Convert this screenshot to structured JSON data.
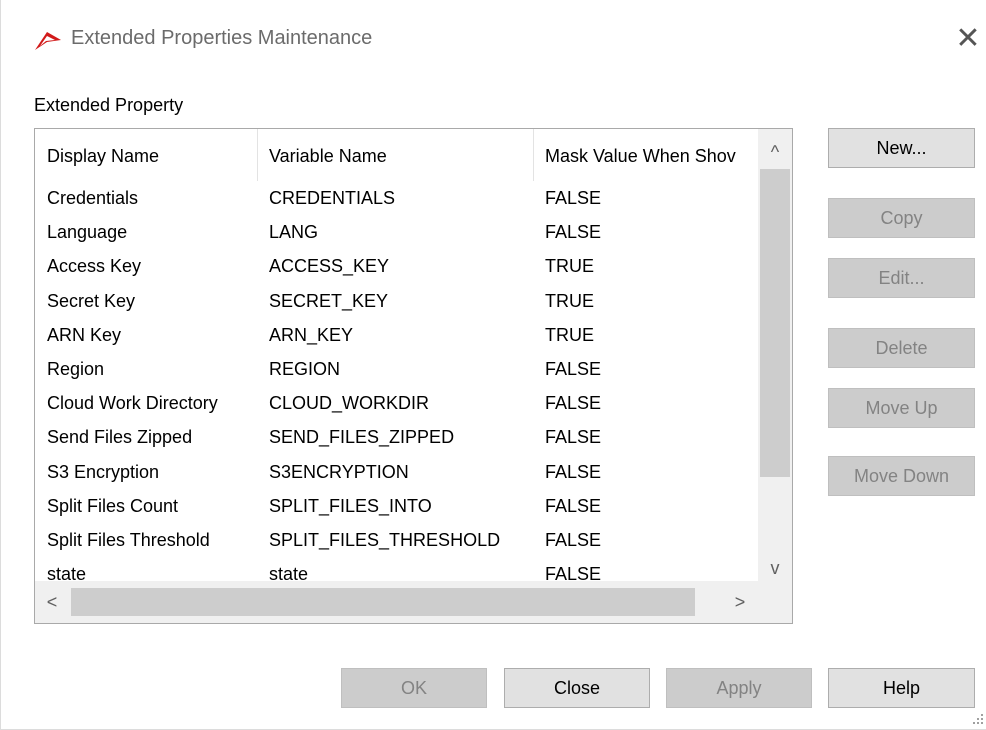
{
  "window": {
    "title": "Extended Properties Maintenance",
    "close_glyph": "✕",
    "icon": "red-arrow-app-icon"
  },
  "group_label": "Extended Property",
  "table": {
    "columns": [
      "Display Name",
      "Variable Name",
      "Mask Value When Shov"
    ],
    "rows": [
      [
        "Credentials",
        "CREDENTIALS",
        "FALSE"
      ],
      [
        "Language",
        "LANG",
        "FALSE"
      ],
      [
        "Access Key",
        "ACCESS_KEY",
        "TRUE"
      ],
      [
        "Secret Key",
        "SECRET_KEY",
        "TRUE"
      ],
      [
        "ARN Key",
        "ARN_KEY",
        "TRUE"
      ],
      [
        "Region",
        "REGION",
        "FALSE"
      ],
      [
        "Cloud Work Directory",
        "CLOUD_WORKDIR",
        "FALSE"
      ],
      [
        "Send Files Zipped",
        "SEND_FILES_ZIPPED",
        "FALSE"
      ],
      [
        "S3 Encryption",
        "S3ENCRYPTION",
        "FALSE"
      ],
      [
        "Split Files Count",
        "SPLIT_FILES_INTO",
        "FALSE"
      ],
      [
        "Split Files Threshold",
        "SPLIT_FILES_THRESHOLD",
        "FALSE"
      ],
      [
        "state",
        "state",
        "FALSE"
      ]
    ],
    "scroll_glyphs": {
      "up": "^",
      "down": "v",
      "left": "<",
      "right": ">"
    }
  },
  "side_buttons": {
    "new": "New...",
    "copy": "Copy",
    "edit": "Edit...",
    "delete": "Delete",
    "move_up": "Move Up",
    "move_down": "Move Down"
  },
  "footer_buttons": {
    "ok": "OK",
    "close": "Close",
    "apply": "Apply",
    "help": "Help"
  },
  "colors": {
    "disabled_button_bg": "#cccccc",
    "button_bg": "#e1e1e1",
    "icon_red": "#d21a1a"
  }
}
